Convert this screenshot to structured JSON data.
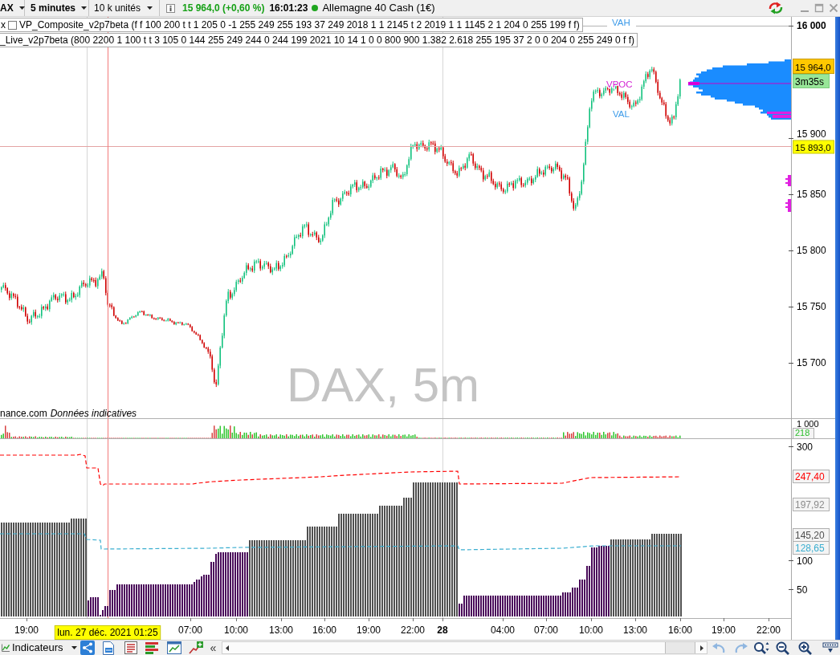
{
  "toolbar": {
    "instrument": "AX",
    "timeframe": "5 minutes",
    "quantity": "10 k unités",
    "quote": "15 964,0 (+0,60 %)",
    "time": "16:01:23",
    "market_open": true,
    "market": "Allemagne 40 Cash (1€)"
  },
  "price_panel": {
    "legends": [
      {
        "kind": "toggle",
        "close": "x",
        "checked": false,
        "text": "VP_Composite_v2p7beta (f f 100 200 t t 1 205 0 -1 255 249 255 193 37 249 2018 1 1 2145 t 2 2019 1 1 1145 2 1 204 0 255 199 f f)"
      },
      {
        "kind": "plain",
        "text": "_Live_v2p7beta (800 2200 1 100 t t 3 105 0 144 255 249 244 0 244 199 2021 10 14 1 0 0 800 900 1.382 2.618 255 195 37 2 0 0 204 0 255 249 0 f f)"
      }
    ],
    "symbol": "DAX, 5m",
    "source": "nance.com",
    "disclaimer": "Données indicatives",
    "profile_levels": [
      {
        "label": "VAH",
        "kind": "value_area"
      },
      {
        "label": "VPOC",
        "kind": "poc"
      },
      {
        "label": "VAL",
        "kind": "value_area"
      }
    ],
    "axis_ticks": [
      {
        "label": "16 000",
        "major": true
      },
      {
        "label": "15 900",
        "major": false
      },
      {
        "label": "15 850",
        "major": false
      },
      {
        "label": "15 800",
        "major": false
      },
      {
        "label": "15 750",
        "major": false
      },
      {
        "label": "15 700",
        "major": false
      }
    ],
    "last_price": "15 964,0",
    "countdown": "3m35s",
    "crosshair_price": "15 893,0"
  },
  "volume_panel": {
    "axis_tick": "1 000",
    "last_volume": "218"
  },
  "indicator_panel": {
    "axis_ticks": [
      "300",
      "100",
      "50"
    ],
    "value_labels": [
      {
        "value": "247,40",
        "color": "#ff0000"
      },
      {
        "value": "197,92",
        "color": "#8c8c8c"
      },
      {
        "value": "145,20",
        "color": "#505050"
      },
      {
        "value": "128,65",
        "color": "#3aaed0"
      }
    ]
  },
  "time_axis": {
    "cursor_label": "lun. 27 déc. 2021 01:25",
    "ticks": [
      {
        "label": "19:00",
        "kind": "time"
      },
      {
        "label": "07:00",
        "kind": "time"
      },
      {
        "label": "10:00",
        "kind": "time"
      },
      {
        "label": "13:00",
        "kind": "time"
      },
      {
        "label": "16:00",
        "kind": "time"
      },
      {
        "label": "19:00",
        "kind": "time"
      },
      {
        "label": "22:00",
        "kind": "time"
      },
      {
        "label": "28",
        "kind": "day"
      },
      {
        "label": "04:00",
        "kind": "time"
      },
      {
        "label": "07:00",
        "kind": "time"
      },
      {
        "label": "10:00",
        "kind": "time"
      },
      {
        "label": "13:00",
        "kind": "time"
      },
      {
        "label": "16:00",
        "kind": "time"
      },
      {
        "label": "19:00",
        "kind": "time"
      },
      {
        "label": "22:00",
        "kind": "time"
      }
    ]
  },
  "bottom_bar": {
    "indicators": "Indicateurs",
    "collapse": "«"
  }
}
